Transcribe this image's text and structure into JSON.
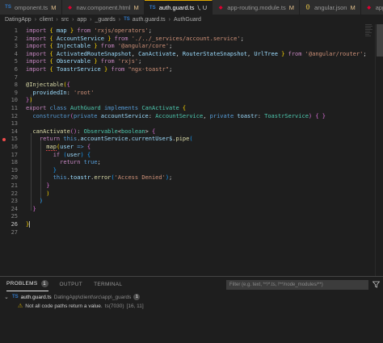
{
  "tabs": [
    {
      "name": "omponent.ts",
      "mod": "M",
      "icon": "ts",
      "active": false
    },
    {
      "name": "nav.component.html",
      "mod": "M",
      "icon": "angular",
      "active": false
    },
    {
      "name": "auth.guard.ts",
      "mod": "\\, U",
      "icon": "ts",
      "active": true
    },
    {
      "name": "app-routing.module.ts",
      "mod": "M",
      "icon": "angular",
      "active": false
    },
    {
      "name": "angular.json",
      "mod": "M",
      "icon": "json",
      "active": false
    },
    {
      "name": "app.module.ts",
      "mod": "M",
      "icon": "angular",
      "active": false
    }
  ],
  "breadcrumbs": [
    "DatingApp",
    "client",
    "src",
    "app",
    "_guards",
    "auth.guard.ts",
    "AuthGuard"
  ],
  "line_numbers": [
    "1",
    "2",
    "3",
    "4",
    "5",
    "6",
    "7",
    "8",
    "9",
    "10",
    "11",
    "12",
    "13",
    "14",
    "15",
    "16",
    "17",
    "18",
    "19",
    "20",
    "21",
    "22",
    "23",
    "24",
    "25",
    "26",
    "27"
  ],
  "panel": {
    "tabs": [
      "PROBLEMS",
      "OUTPUT",
      "TERMINAL"
    ],
    "problem_count": "1",
    "filter_placeholder": "Filter (e.g. text, **/*.ts, !**/node_modules/**)",
    "file": {
      "name": "auth.guard.ts",
      "path": "DatingApp\\client\\src\\app\\_guards",
      "count": "1"
    },
    "problem": {
      "message": "Not all code paths return a value.",
      "code": "ts(7030)",
      "location": "[16, 11]"
    }
  }
}
